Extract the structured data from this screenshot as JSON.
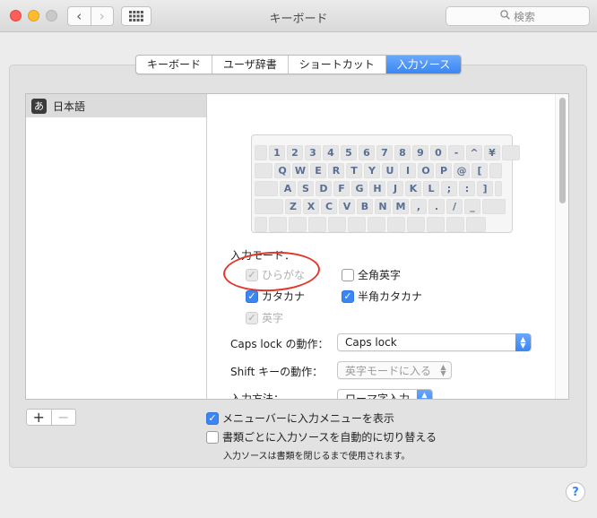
{
  "window": {
    "title": "キーボード",
    "back_glyph": "‹",
    "forward_glyph": "›",
    "search_placeholder": "検索",
    "search_icon": "magnifier-icon",
    "grid_icon": "show-all-grid-icon"
  },
  "tabs": [
    {
      "label": "キーボード",
      "active": false
    },
    {
      "label": "ユーザ辞書",
      "active": false
    },
    {
      "label": "ショートカット",
      "active": false
    },
    {
      "label": "入力ソース",
      "active": true
    }
  ],
  "sources": [
    {
      "icon_glyph": "あ",
      "label": "日本語",
      "selected": true
    }
  ],
  "keyboard_rows": [
    [
      "",
      "1",
      "2",
      "3",
      "4",
      "5",
      "6",
      "7",
      "8",
      "9",
      "0",
      "-",
      "^",
      "¥",
      ""
    ],
    [
      "",
      "Q",
      "W",
      "E",
      "R",
      "T",
      "Y",
      "U",
      "I",
      "O",
      "P",
      "@",
      "[",
      ""
    ],
    [
      "",
      "A",
      "S",
      "D",
      "F",
      "G",
      "H",
      "J",
      "K",
      "L",
      ";",
      ":",
      "]",
      ""
    ],
    [
      "",
      "Z",
      "X",
      "C",
      "V",
      "B",
      "N",
      "M",
      ",",
      ".",
      "/",
      "_",
      ""
    ],
    [
      "",
      "",
      "",
      "",
      "",
      "",
      "",
      "",
      "",
      "",
      "",
      ""
    ]
  ],
  "input_modes": {
    "label": "入力モード：",
    "hiragana": {
      "label": "ひらがな",
      "checked": true,
      "disabled": true
    },
    "zenkaku_eiji": {
      "label": "全角英字",
      "checked": false,
      "disabled": false
    },
    "katakana": {
      "label": "カタカナ",
      "checked": true,
      "disabled": false
    },
    "hankaku_katakana": {
      "label": "半角カタカナ",
      "checked": true,
      "disabled": false
    },
    "eiji": {
      "label": "英字",
      "checked": true,
      "disabled": true
    }
  },
  "settings": {
    "caps_lock_label": "Caps lock の動作：",
    "caps_lock_value": "Caps lock",
    "shift_label": "Shift キーの動作：",
    "shift_value": "英字モードに入る",
    "input_method_label": "入力方法：",
    "input_method_value": "ローマ字入力"
  },
  "bottom": {
    "add_glyph": "+",
    "remove_glyph": "−",
    "show_menu_label": "メニューバーに入力メニューを表示",
    "show_menu_checked": true,
    "auto_switch_label": "書類ごとに入力ソースを自動的に切り替える",
    "auto_switch_checked": false,
    "auto_switch_note": "入力ソースは書類を閉じるまで使用されます。",
    "help_glyph": "?"
  },
  "colors": {
    "accent": "#3a86f4",
    "annotation_circle": "#e2382b",
    "key_text": "#5a6f96"
  }
}
